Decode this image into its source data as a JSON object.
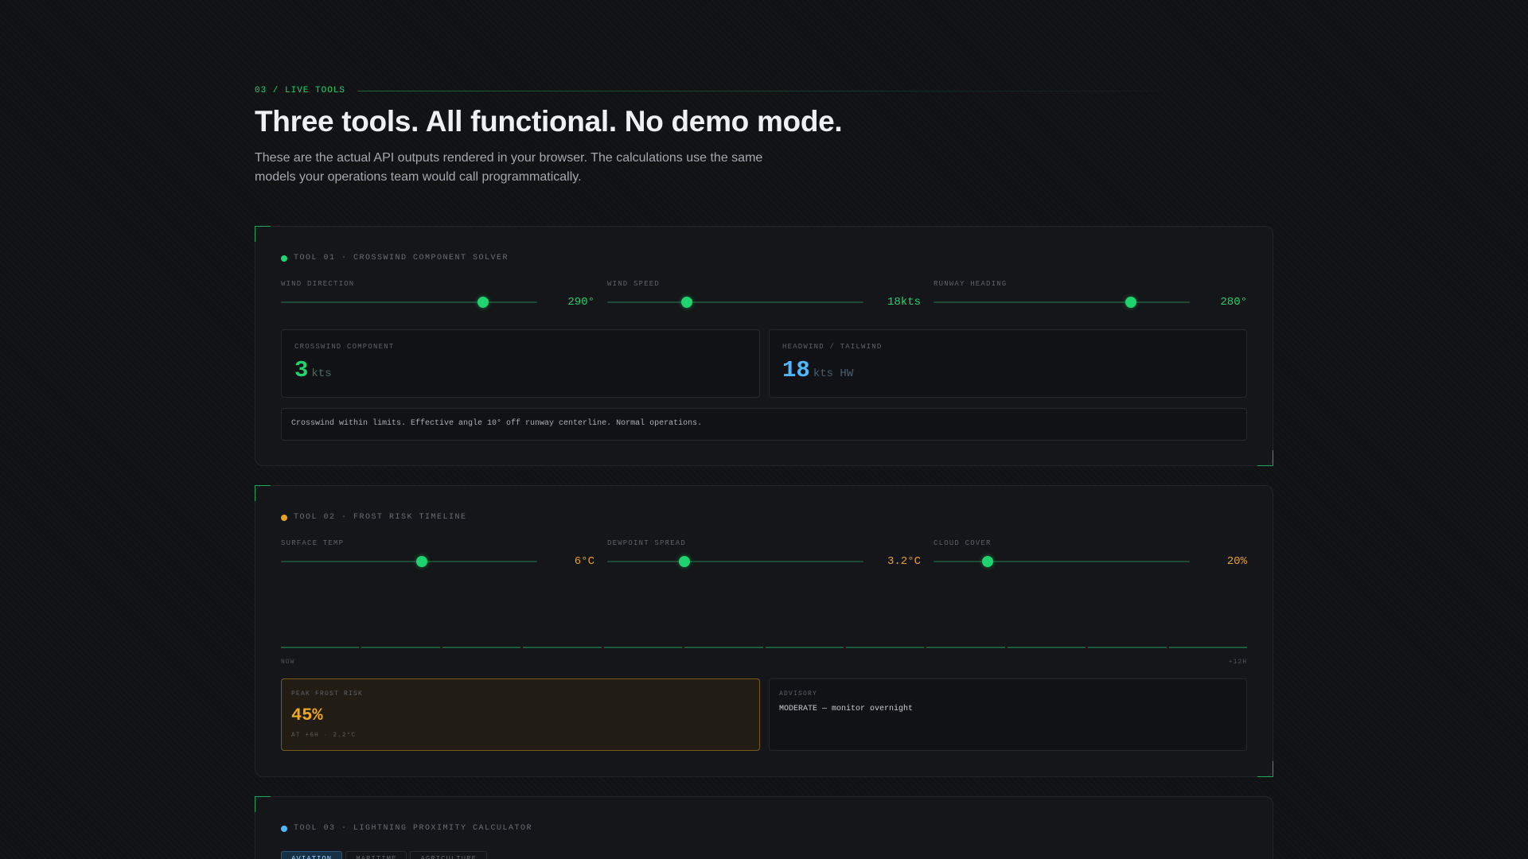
{
  "section": {
    "eyebrow": "03 / LIVE TOOLS",
    "title": "Three tools. All functional. No demo mode.",
    "lede": "These are the actual API outputs rendered in your browser. The calculations use the same models your operations team would call programmatically."
  },
  "tool1": {
    "title": "TOOL 01 · CROSSWIND COMPONENT SOLVER",
    "status_color": "#1fd46e",
    "sliders": [
      {
        "label": "WIND DIRECTION",
        "value": "290°",
        "fraction": 0.79
      },
      {
        "label": "WIND SPEED",
        "value": "18kts",
        "fraction": 0.31
      },
      {
        "label": "RUNWAY HEADING",
        "value": "280°",
        "fraction": 0.77
      }
    ],
    "crosswind": {
      "label": "CROSSWIND COMPONENT",
      "value": "3",
      "unit": "kts",
      "color": "#1fd46e"
    },
    "headwind": {
      "label": "HEADWIND / TAILWIND",
      "value": "18",
      "unit": "kts HW",
      "color": "#4db8ff"
    },
    "note": "Crosswind within limits. Effective angle 10° off runway centerline. Normal operations."
  },
  "tool2": {
    "title": "TOOL 02 · FROST RISK TIMELINE",
    "status_color": "#e8a021",
    "sliders": [
      {
        "label": "SURFACE TEMP",
        "value": "6°C",
        "fraction": 0.55
      },
      {
        "label": "DEWPOINT SPREAD",
        "value": "3.2°C",
        "fraction": 0.3
      },
      {
        "label": "CLOUD COVER",
        "value": "20%",
        "fraction": 0.21
      }
    ],
    "timeline": {
      "start": "NOW",
      "end": "+12H",
      "segments": 12
    },
    "peak": {
      "label": "PEAK FROST RISK",
      "value": "45%",
      "sub": "AT +6H · 2.2°C"
    },
    "advisory": {
      "label": "ADVISORY",
      "text": "MODERATE — monitor overnight"
    }
  },
  "tool3": {
    "title": "TOOL 03 · LIGHTNING PROXIMITY CALCULATOR",
    "status_color": "#4db8ff",
    "tabs": [
      "AVIATION",
      "MARITIME",
      "AGRICULTURE"
    ],
    "active_tab": "AVIATION"
  }
}
